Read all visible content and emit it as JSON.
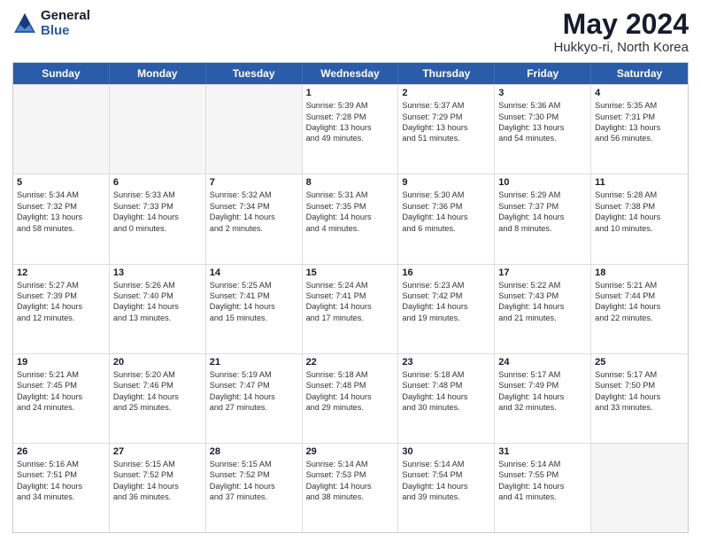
{
  "logo": {
    "general": "General",
    "blue": "Blue"
  },
  "title": "May 2024",
  "location": "Hukkyo-ri, North Korea",
  "days_of_week": [
    "Sunday",
    "Monday",
    "Tuesday",
    "Wednesday",
    "Thursday",
    "Friday",
    "Saturday"
  ],
  "weeks": [
    [
      {
        "day": "",
        "empty": true
      },
      {
        "day": "",
        "empty": true
      },
      {
        "day": "",
        "empty": true
      },
      {
        "day": "1",
        "lines": [
          "Sunrise: 5:39 AM",
          "Sunset: 7:28 PM",
          "Daylight: 13 hours",
          "and 49 minutes."
        ]
      },
      {
        "day": "2",
        "lines": [
          "Sunrise: 5:37 AM",
          "Sunset: 7:29 PM",
          "Daylight: 13 hours",
          "and 51 minutes."
        ]
      },
      {
        "day": "3",
        "lines": [
          "Sunrise: 5:36 AM",
          "Sunset: 7:30 PM",
          "Daylight: 13 hours",
          "and 54 minutes."
        ]
      },
      {
        "day": "4",
        "lines": [
          "Sunrise: 5:35 AM",
          "Sunset: 7:31 PM",
          "Daylight: 13 hours",
          "and 56 minutes."
        ]
      }
    ],
    [
      {
        "day": "5",
        "lines": [
          "Sunrise: 5:34 AM",
          "Sunset: 7:32 PM",
          "Daylight: 13 hours",
          "and 58 minutes."
        ]
      },
      {
        "day": "6",
        "lines": [
          "Sunrise: 5:33 AM",
          "Sunset: 7:33 PM",
          "Daylight: 14 hours",
          "and 0 minutes."
        ]
      },
      {
        "day": "7",
        "lines": [
          "Sunrise: 5:32 AM",
          "Sunset: 7:34 PM",
          "Daylight: 14 hours",
          "and 2 minutes."
        ]
      },
      {
        "day": "8",
        "lines": [
          "Sunrise: 5:31 AM",
          "Sunset: 7:35 PM",
          "Daylight: 14 hours",
          "and 4 minutes."
        ]
      },
      {
        "day": "9",
        "lines": [
          "Sunrise: 5:30 AM",
          "Sunset: 7:36 PM",
          "Daylight: 14 hours",
          "and 6 minutes."
        ]
      },
      {
        "day": "10",
        "lines": [
          "Sunrise: 5:29 AM",
          "Sunset: 7:37 PM",
          "Daylight: 14 hours",
          "and 8 minutes."
        ]
      },
      {
        "day": "11",
        "lines": [
          "Sunrise: 5:28 AM",
          "Sunset: 7:38 PM",
          "Daylight: 14 hours",
          "and 10 minutes."
        ]
      }
    ],
    [
      {
        "day": "12",
        "lines": [
          "Sunrise: 5:27 AM",
          "Sunset: 7:39 PM",
          "Daylight: 14 hours",
          "and 12 minutes."
        ]
      },
      {
        "day": "13",
        "lines": [
          "Sunrise: 5:26 AM",
          "Sunset: 7:40 PM",
          "Daylight: 14 hours",
          "and 13 minutes."
        ]
      },
      {
        "day": "14",
        "lines": [
          "Sunrise: 5:25 AM",
          "Sunset: 7:41 PM",
          "Daylight: 14 hours",
          "and 15 minutes."
        ]
      },
      {
        "day": "15",
        "lines": [
          "Sunrise: 5:24 AM",
          "Sunset: 7:41 PM",
          "Daylight: 14 hours",
          "and 17 minutes."
        ]
      },
      {
        "day": "16",
        "lines": [
          "Sunrise: 5:23 AM",
          "Sunset: 7:42 PM",
          "Daylight: 14 hours",
          "and 19 minutes."
        ]
      },
      {
        "day": "17",
        "lines": [
          "Sunrise: 5:22 AM",
          "Sunset: 7:43 PM",
          "Daylight: 14 hours",
          "and 21 minutes."
        ]
      },
      {
        "day": "18",
        "lines": [
          "Sunrise: 5:21 AM",
          "Sunset: 7:44 PM",
          "Daylight: 14 hours",
          "and 22 minutes."
        ]
      }
    ],
    [
      {
        "day": "19",
        "lines": [
          "Sunrise: 5:21 AM",
          "Sunset: 7:45 PM",
          "Daylight: 14 hours",
          "and 24 minutes."
        ]
      },
      {
        "day": "20",
        "lines": [
          "Sunrise: 5:20 AM",
          "Sunset: 7:46 PM",
          "Daylight: 14 hours",
          "and 25 minutes."
        ]
      },
      {
        "day": "21",
        "lines": [
          "Sunrise: 5:19 AM",
          "Sunset: 7:47 PM",
          "Daylight: 14 hours",
          "and 27 minutes."
        ]
      },
      {
        "day": "22",
        "lines": [
          "Sunrise: 5:18 AM",
          "Sunset: 7:48 PM",
          "Daylight: 14 hours",
          "and 29 minutes."
        ]
      },
      {
        "day": "23",
        "lines": [
          "Sunrise: 5:18 AM",
          "Sunset: 7:48 PM",
          "Daylight: 14 hours",
          "and 30 minutes."
        ]
      },
      {
        "day": "24",
        "lines": [
          "Sunrise: 5:17 AM",
          "Sunset: 7:49 PM",
          "Daylight: 14 hours",
          "and 32 minutes."
        ]
      },
      {
        "day": "25",
        "lines": [
          "Sunrise: 5:17 AM",
          "Sunset: 7:50 PM",
          "Daylight: 14 hours",
          "and 33 minutes."
        ]
      }
    ],
    [
      {
        "day": "26",
        "lines": [
          "Sunrise: 5:16 AM",
          "Sunset: 7:51 PM",
          "Daylight: 14 hours",
          "and 34 minutes."
        ]
      },
      {
        "day": "27",
        "lines": [
          "Sunrise: 5:15 AM",
          "Sunset: 7:52 PM",
          "Daylight: 14 hours",
          "and 36 minutes."
        ]
      },
      {
        "day": "28",
        "lines": [
          "Sunrise: 5:15 AM",
          "Sunset: 7:52 PM",
          "Daylight: 14 hours",
          "and 37 minutes."
        ]
      },
      {
        "day": "29",
        "lines": [
          "Sunrise: 5:14 AM",
          "Sunset: 7:53 PM",
          "Daylight: 14 hours",
          "and 38 minutes."
        ]
      },
      {
        "day": "30",
        "lines": [
          "Sunrise: 5:14 AM",
          "Sunset: 7:54 PM",
          "Daylight: 14 hours",
          "and 39 minutes."
        ]
      },
      {
        "day": "31",
        "lines": [
          "Sunrise: 5:14 AM",
          "Sunset: 7:55 PM",
          "Daylight: 14 hours",
          "and 41 minutes."
        ]
      },
      {
        "day": "",
        "empty": true
      }
    ]
  ]
}
